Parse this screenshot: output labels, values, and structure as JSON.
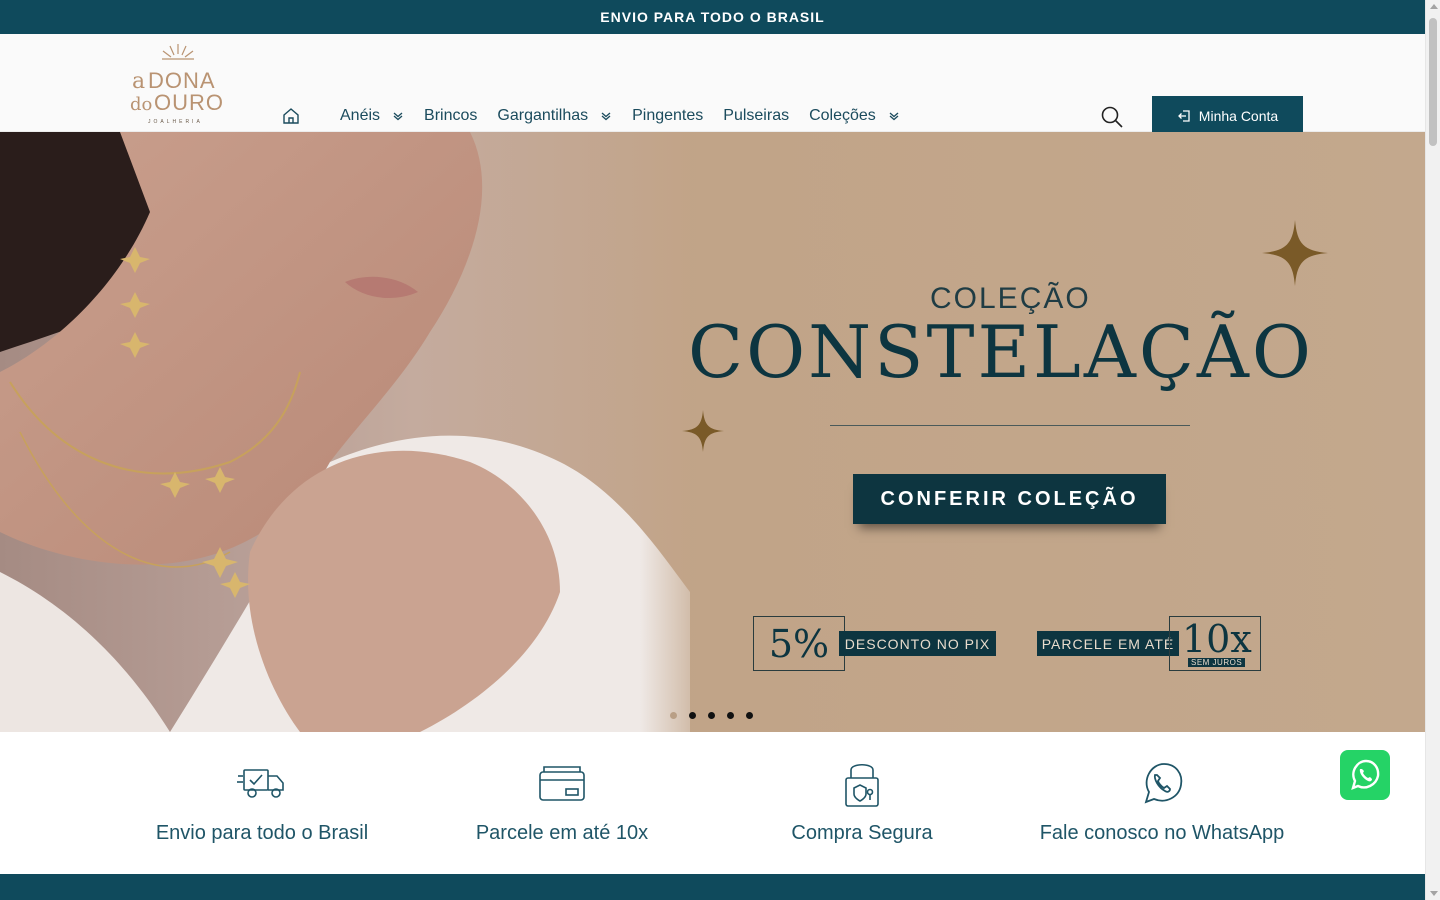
{
  "topbar": {
    "text": "ENVIO PARA TODO O BRASIL"
  },
  "header": {
    "logo": {
      "line1": "a DONA",
      "line2": "do OURO",
      "tagline": "JOALHERIA"
    },
    "nav": [
      {
        "label": "Anéis",
        "has_dropdown": true
      },
      {
        "label": "Brincos",
        "has_dropdown": false
      },
      {
        "label": "Gargantilhas",
        "has_dropdown": true
      },
      {
        "label": "Pingentes",
        "has_dropdown": false
      },
      {
        "label": "Pulseiras",
        "has_dropdown": false
      },
      {
        "label": "Coleções",
        "has_dropdown": true
      }
    ],
    "account_label": "Minha Conta"
  },
  "hero": {
    "kicker": "COLEÇÃO",
    "title": "CONSTELAÇÃO",
    "cta": "CONFERIR COLEÇÃO",
    "promo_pix": {
      "value": "5%",
      "label": "DESCONTO NO PIX"
    },
    "promo_parcelas": {
      "label": "PARCELE EM ATÉ",
      "value": "10x",
      "sub": "SEM JUROS"
    },
    "slides": 5,
    "active_slide": 1
  },
  "features": [
    {
      "icon": "delivery-truck-icon",
      "label": "Envio para todo o Brasil"
    },
    {
      "icon": "credit-card-icon",
      "label": "Parcele em até 10x"
    },
    {
      "icon": "secure-lock-icon",
      "label": "Compra Segura"
    },
    {
      "icon": "whatsapp-icon",
      "label": "Fale conosco no WhatsApp"
    }
  ],
  "colors": {
    "brand": "#0f4a5c",
    "hero_bg": "#c1a488",
    "gold": "#8a6a2f"
  }
}
